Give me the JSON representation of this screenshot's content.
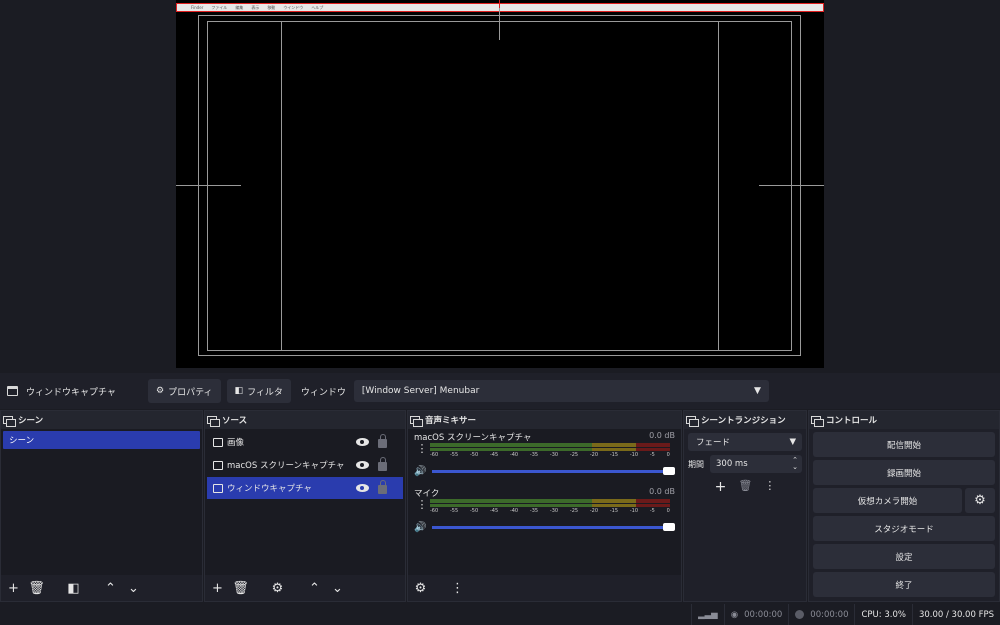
{
  "preview": {
    "menubar": [
      "",
      "Finder",
      "ファイル",
      "編集",
      "表示",
      "移動",
      "ウインドウ",
      "ヘルプ"
    ]
  },
  "context_bar": {
    "source_name": "ウィンドウキャプチャ",
    "properties_label": "プロパティ",
    "filters_label": "フィルタ",
    "window_label": "ウィンドウ",
    "window_value": "[Window Server] Menubar"
  },
  "scenes": {
    "title": "シーン",
    "items": [
      "シーン"
    ]
  },
  "sources": {
    "title": "ソース",
    "items": [
      {
        "label": "画像",
        "icon": "image-icon"
      },
      {
        "label": "macOS スクリーンキャプチャ",
        "icon": "monitor-icon"
      },
      {
        "label": "ウィンドウキャプチャ",
        "icon": "window-icon"
      }
    ]
  },
  "mixer": {
    "title": "音声ミキサー",
    "channels": [
      {
        "name": "macOS スクリーンキャプチャ",
        "db": "0.0 dB",
        "volume": 1.0
      },
      {
        "name": "マイク",
        "db": "0.0 dB",
        "volume": 1.0
      }
    ],
    "ticks": [
      "-60",
      "-55",
      "-50",
      "-45",
      "-40",
      "-35",
      "-30",
      "-25",
      "-20",
      "-15",
      "-10",
      "-5",
      "0"
    ]
  },
  "transitions": {
    "title": "シーントランジション",
    "type": "フェード",
    "duration_label": "期間",
    "duration": "300 ms"
  },
  "controls": {
    "title": "コントロール",
    "start_streaming": "配信開始",
    "start_recording": "録画開始",
    "start_virtual_cam": "仮想カメラ開始",
    "studio_mode": "スタジオモード",
    "settings": "設定",
    "exit": "終了"
  },
  "status": {
    "stream_time": "00:00:00",
    "record_time": "00:00:00",
    "cpu": "CPU: 3.0%",
    "fps": "30.00 / 30.00 FPS"
  },
  "colors": {
    "selected": "#2a3cae",
    "background": "#1b1c23",
    "panel": "#1f2029",
    "button": "#2c2e39"
  }
}
